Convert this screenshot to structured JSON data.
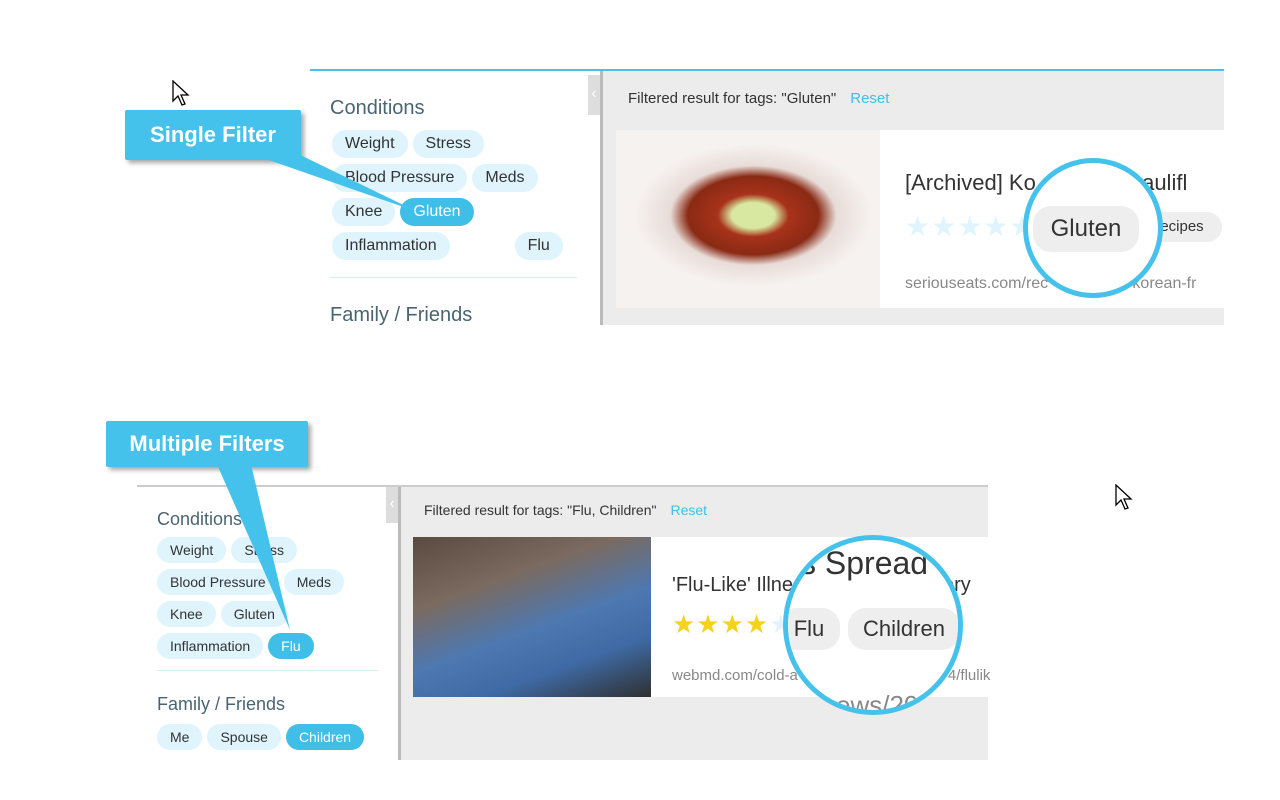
{
  "colors": {
    "accent": "#45c2eb",
    "tag_bg": "#dff4fc",
    "star_on": "#f5d21c",
    "star_off": "#dff4fc"
  },
  "top": {
    "callout": "Single Filter",
    "conditions_heading": "Conditions",
    "condition_tags": [
      "Weight",
      "Stress",
      "Blood Pressure",
      "Meds",
      "Knee",
      "Gluten",
      "Inflammation",
      "Flu"
    ],
    "active_tags": [
      "Gluten"
    ],
    "family_heading": "Family / Friends",
    "filter_text": "Filtered result for tags: \"Gluten\"",
    "reset": "Reset",
    "result": {
      "title": "[Archived] Ko",
      "title_end": "d Caulifl",
      "rating": 0,
      "tags": [
        "Gluten",
        "ecipes"
      ],
      "url": "seriouseats.com/rec",
      "url_end": "02/korean-fr"
    },
    "magnified_tag": "Gluten"
  },
  "bottom": {
    "callout": "Multiple Filters",
    "conditions_heading": "Conditions",
    "condition_tags": [
      "Weight",
      "Stress",
      "Blood Pressure",
      "Meds",
      "Knee",
      "Gluten",
      "Inflammation",
      "Flu"
    ],
    "active_tags": [
      "Flu",
      "Children"
    ],
    "family_heading": "Family / Friends",
    "family_tags": [
      "Me",
      "Spouse",
      "Children"
    ],
    "filter_text": "Filtered result for tags: \"Flu, Children\"",
    "reset": "Reset",
    "result": {
      "title": "'Flu-Like' Illne",
      "title_end": "ery",
      "rating": 4,
      "max_rating": 5,
      "url": "webmd.com/cold-a",
      "url_end": "4/flulik"
    },
    "magnified_title": "s Spread",
    "magnified_tags": [
      "Flu",
      "Children"
    ],
    "magnified_url": "ews/20"
  }
}
